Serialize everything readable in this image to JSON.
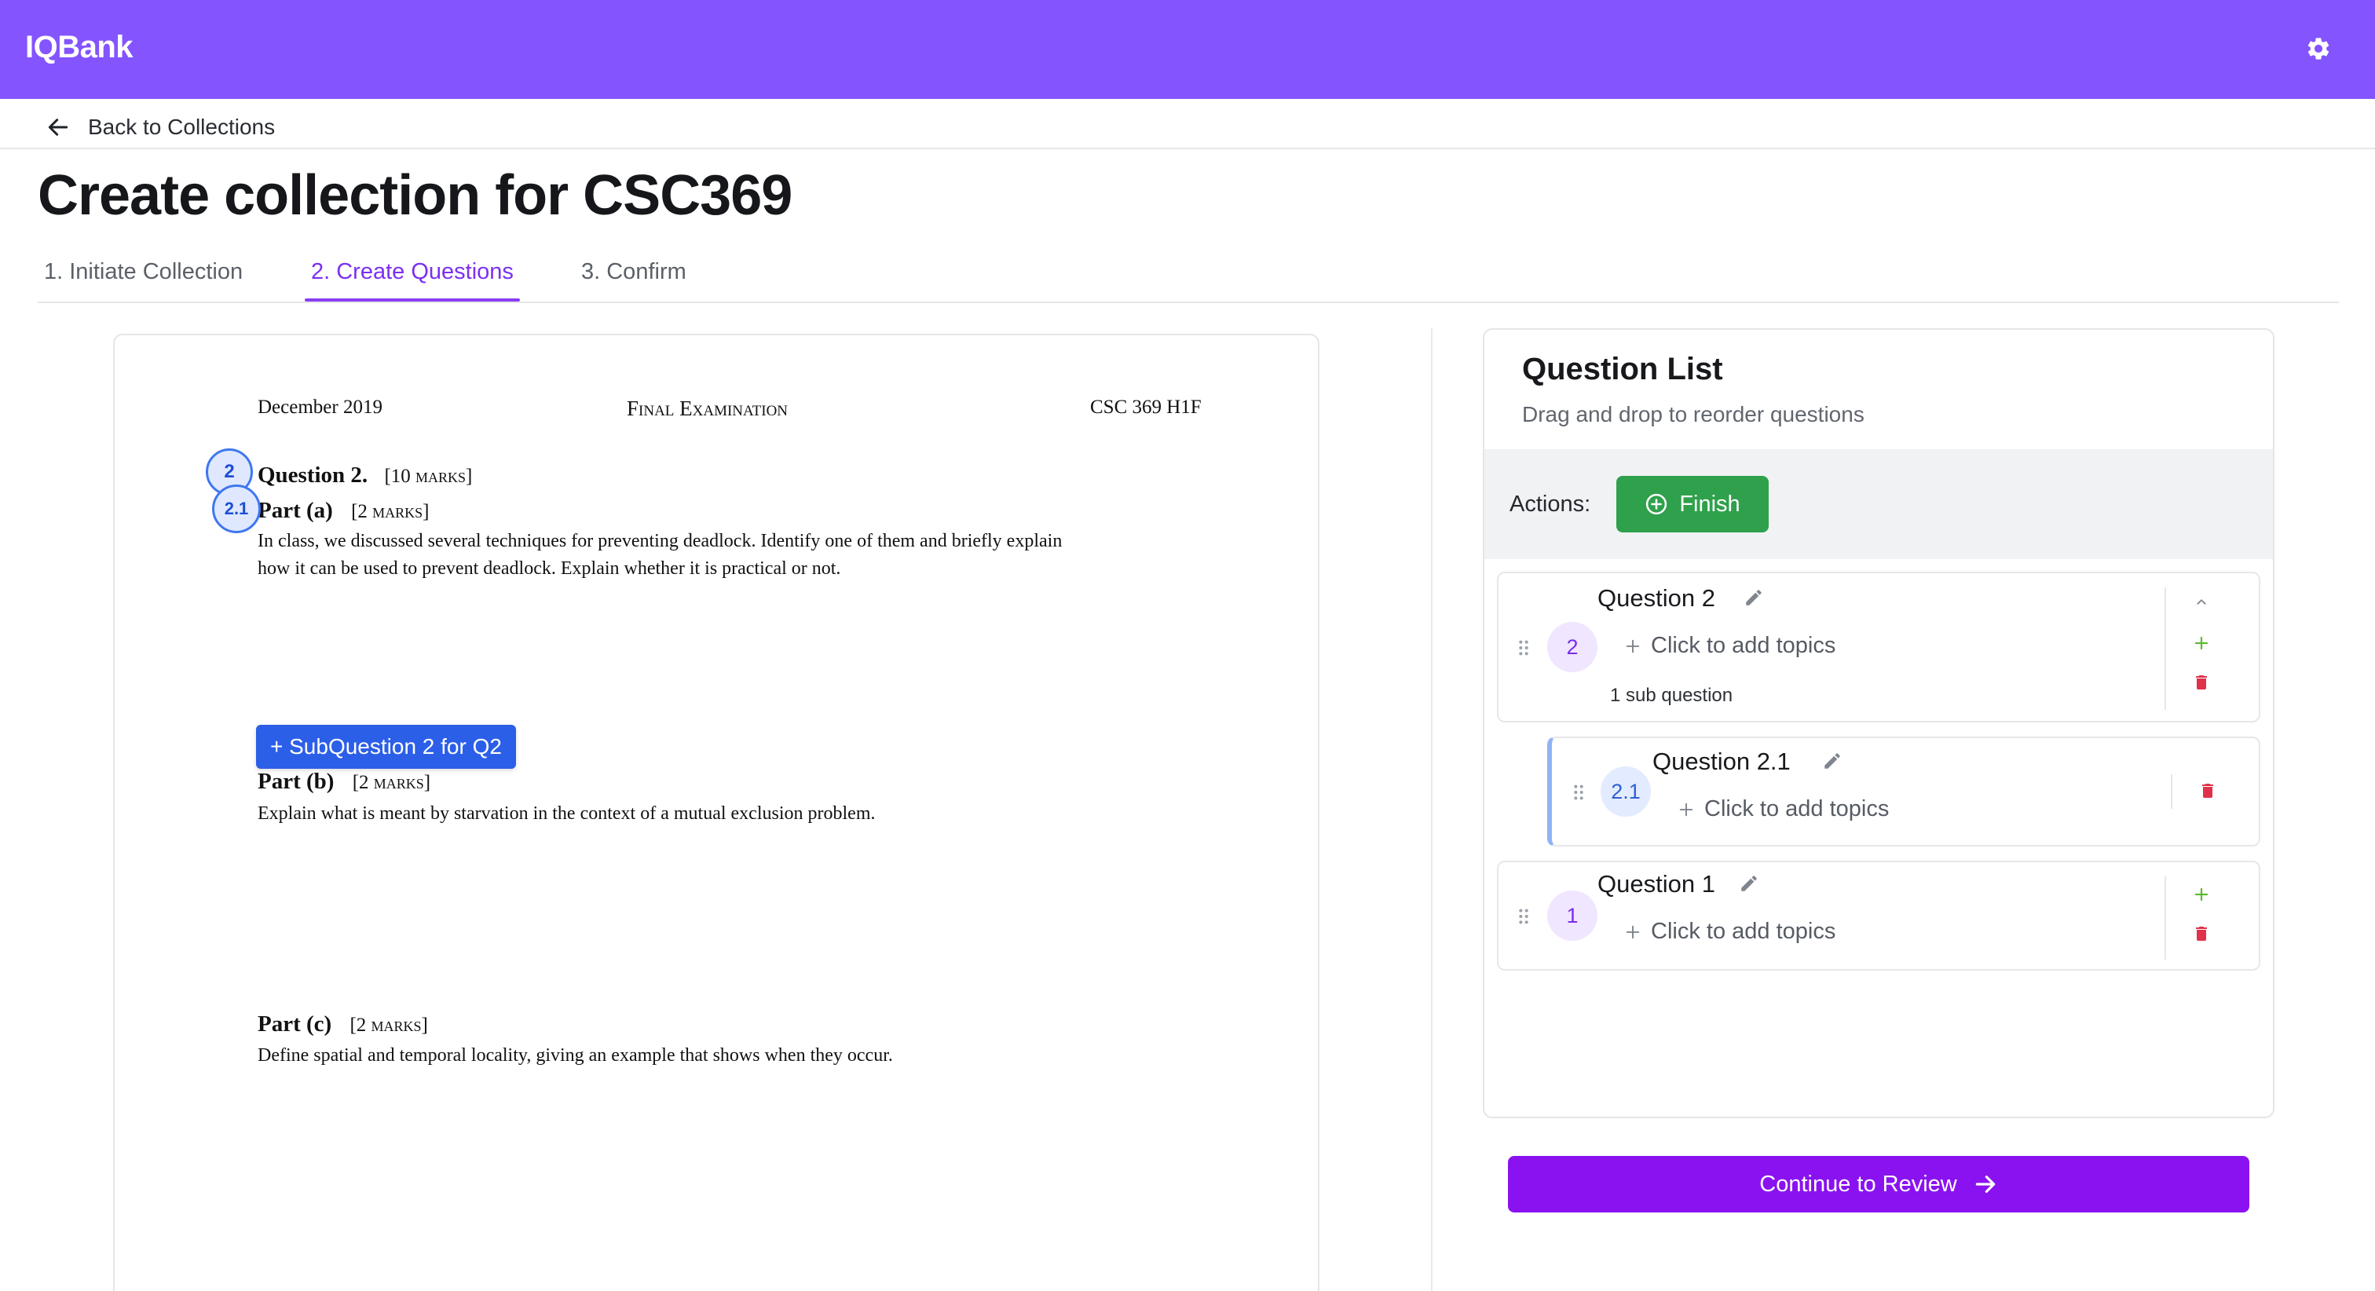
{
  "app": {
    "brand": "IQBank"
  },
  "nav": {
    "back_label": "Back to Collections"
  },
  "page": {
    "title": "Create collection for CSC369"
  },
  "tabs": [
    {
      "label": "1. Initiate Collection",
      "active": false
    },
    {
      "label": "2. Create Questions",
      "active": true
    },
    {
      "label": "3. Confirm",
      "active": false
    }
  ],
  "document": {
    "header_left": "December 2019",
    "header_center": "Final Examination",
    "header_right": "CSC 369 H1F",
    "question_title": "Question 2.",
    "question_marks": "[10 marks]",
    "part_a_title": "Part (a)",
    "part_a_marks": "[2 marks]",
    "part_a_text_1": "In class, we discussed several techniques for preventing deadlock. Identify one of them and briefly explain",
    "part_a_text_2": "how it can be used to prevent deadlock. Explain whether it is practical or not.",
    "part_b_title": "Part (b)",
    "part_b_marks": "[2 marks]",
    "part_b_text": "Explain what is meant by starvation in the context of a mutual exclusion problem.",
    "part_c_title": "Part (c)",
    "part_c_marks": "[2 marks]",
    "part_c_text": "Define spatial and temporal locality, giving an example that shows when they occur.",
    "markers": {
      "q2": "2",
      "q21": "2.1"
    },
    "subquestion_button": "+ SubQuestion 2 for Q2"
  },
  "question_list": {
    "title": "Question List",
    "subtitle": "Drag and drop to reorder questions",
    "actions_label": "Actions:",
    "finish_label": "Finish",
    "items": [
      {
        "badge": "2",
        "name": "Question 2",
        "topics_placeholder": "Click to add topics",
        "sub_count": "1 sub question"
      },
      {
        "badge": "2.1",
        "name": "Question 2.1",
        "topics_placeholder": "Click to add topics"
      },
      {
        "badge": "1",
        "name": "Question 1",
        "topics_placeholder": "Click to add topics"
      }
    ]
  },
  "footer": {
    "continue_label": "Continue to Review"
  },
  "colors": {
    "brand": "#8454ff",
    "accent": "#8a12f0",
    "success": "#2fa04b",
    "danger": "#e0314b",
    "subquestion": "#2c5fe8"
  },
  "icons": [
    "gear-icon",
    "arrow-left-icon",
    "plus-circle-icon",
    "drag-handle-icon",
    "pencil-icon",
    "plus-icon",
    "chevron-up-icon",
    "trash-icon",
    "arrow-right-icon"
  ]
}
